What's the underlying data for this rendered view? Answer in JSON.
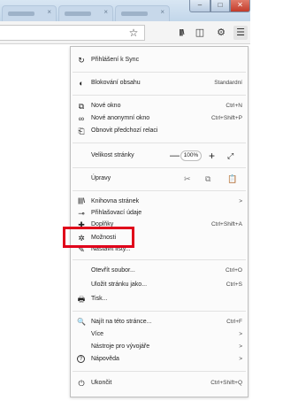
{
  "window": {
    "tab_close_glyph": "×",
    "min_glyph": "–",
    "max_glyph": "□",
    "close_glyph": "✕"
  },
  "toolbar": {
    "bookmark_star_glyph": "☆",
    "library_glyph": "|||\\",
    "sidebar_glyph": "◫",
    "extension_glyph": "⚙",
    "menu_glyph": "☰"
  },
  "menu": {
    "sync": {
      "label": "Přihlášení k Sync",
      "icon": "↻"
    },
    "content_blocking": {
      "label": "Blokování obsahu",
      "value": "Standardní",
      "icon": "◐"
    },
    "new_window": {
      "label": "Nové okno",
      "shortcut": "Ctrl+N",
      "icon": "⧉"
    },
    "new_private_window": {
      "label": "Nové anonymní okno",
      "shortcut": "Ctrl+Shift+P",
      "icon": "∞"
    },
    "restore_session": {
      "label": "Obnovit předchozí relaci",
      "icon": "⎗"
    },
    "zoom": {
      "label": "Velikost stránky",
      "minus": "—",
      "value": "100%",
      "plus": "+",
      "fullscreen": "⤢"
    },
    "edit": {
      "label": "Úpravy",
      "cut": "✂",
      "copy": "⧉",
      "paste": "📋"
    },
    "library": {
      "label": "Knihovna stránek",
      "icon": "|||\\",
      "arrow": ">"
    },
    "logins": {
      "label": "Přihlašovací údaje",
      "icon": "⊸"
    },
    "addons": {
      "label": "Doplňky",
      "shortcut": "Ctrl+Shift+A",
      "icon": "✚"
    },
    "options": {
      "label": "Možnosti",
      "icon": "✲"
    },
    "customize": {
      "label": "Nastavit lišty...",
      "icon": "✎"
    },
    "open_file": {
      "label": "Otevřít soubor...",
      "shortcut": "Ctrl+O"
    },
    "save_page": {
      "label": "Uložit stránku jako...",
      "shortcut": "Ctrl+S"
    },
    "print": {
      "label": "Tisk...",
      "icon": "🖶"
    },
    "find": {
      "label": "Najít na této stránce...",
      "shortcut": "Ctrl+F",
      "icon": "🔍"
    },
    "more": {
      "label": "Více",
      "arrow": ">"
    },
    "web_developer": {
      "label": "Nástroje pro vývojáře",
      "arrow": ">"
    },
    "help": {
      "label": "Nápověda",
      "arrow": ">",
      "icon": "?"
    },
    "quit": {
      "label": "Ukončit",
      "shortcut": "Ctrl+Shift+Q",
      "icon": "⏻"
    }
  },
  "highlight_color": "#e0001a"
}
